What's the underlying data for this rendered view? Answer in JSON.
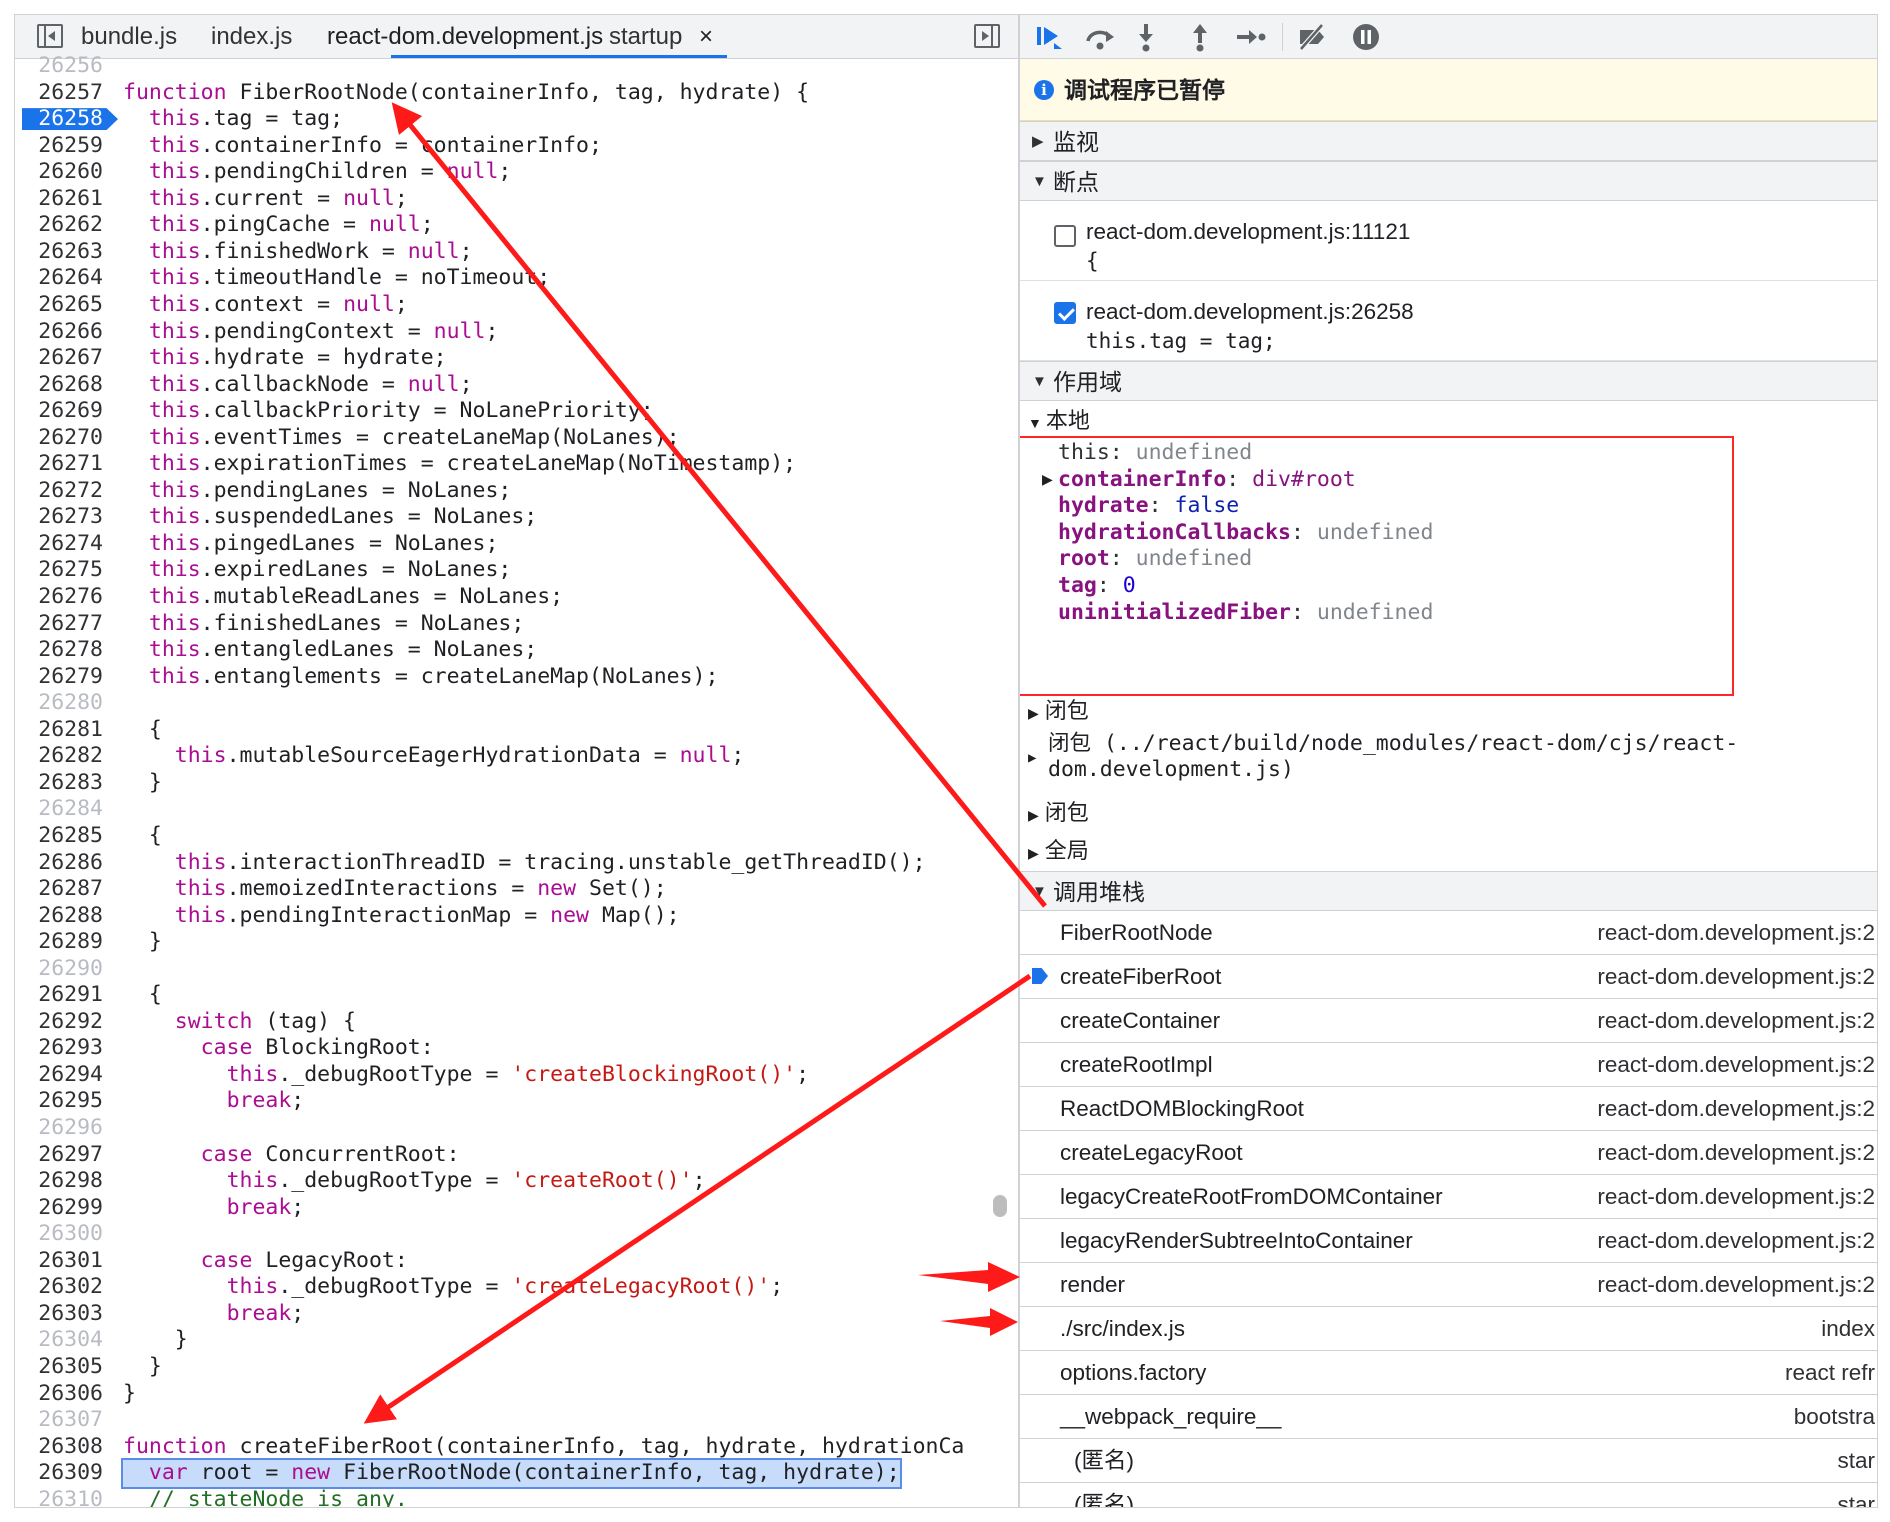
{
  "editor": {
    "tabs": [
      "bundle.js",
      "index.js",
      "react-dom.development.js",
      "startup"
    ],
    "close_glyph": "×",
    "lines": [
      {
        "num": "26256",
        "dim": true,
        "html": ""
      },
      {
        "num": "26257",
        "html": "<span class=\"kw\">function</span> FiberRootNode(containerInfo, tag, hydrate) {"
      },
      {
        "num": "26258",
        "breakpoint": true,
        "html": "  <span class=\"k\">this</span>.tag = tag;"
      },
      {
        "num": "26259",
        "html": "  <span class=\"k\">this</span>.containerInfo = containerInfo;"
      },
      {
        "num": "26260",
        "html": "  <span class=\"k\">this</span>.pendingChildren = <span class=\"k\">null</span>;"
      },
      {
        "num": "26261",
        "html": "  <span class=\"k\">this</span>.current = <span class=\"k\">null</span>;"
      },
      {
        "num": "26262",
        "html": "  <span class=\"k\">this</span>.pingCache = <span class=\"k\">null</span>;"
      },
      {
        "num": "26263",
        "html": "  <span class=\"k\">this</span>.finishedWork = <span class=\"k\">null</span>;"
      },
      {
        "num": "26264",
        "html": "  <span class=\"k\">this</span>.timeoutHandle = noTimeout;"
      },
      {
        "num": "26265",
        "html": "  <span class=\"k\">this</span>.context = <span class=\"k\">null</span>;"
      },
      {
        "num": "26266",
        "html": "  <span class=\"k\">this</span>.pendingContext = <span class=\"k\">null</span>;"
      },
      {
        "num": "26267",
        "html": "  <span class=\"k\">this</span>.hydrate = hydrate;"
      },
      {
        "num": "26268",
        "html": "  <span class=\"k\">this</span>.callbackNode = <span class=\"k\">null</span>;"
      },
      {
        "num": "26269",
        "html": "  <span class=\"k\">this</span>.callbackPriority = NoLanePriority;"
      },
      {
        "num": "26270",
        "html": "  <span class=\"k\">this</span>.eventTimes = createLaneMap(NoLanes);"
      },
      {
        "num": "26271",
        "html": "  <span class=\"k\">this</span>.expirationTimes = createLaneMap(NoTimestamp);"
      },
      {
        "num": "26272",
        "html": "  <span class=\"k\">this</span>.pendingLanes = NoLanes;"
      },
      {
        "num": "26273",
        "html": "  <span class=\"k\">this</span>.suspendedLanes = NoLanes;"
      },
      {
        "num": "26274",
        "html": "  <span class=\"k\">this</span>.pingedLanes = NoLanes;"
      },
      {
        "num": "26275",
        "html": "  <span class=\"k\">this</span>.expiredLanes = NoLanes;"
      },
      {
        "num": "26276",
        "html": "  <span class=\"k\">this</span>.mutableReadLanes = NoLanes;"
      },
      {
        "num": "26277",
        "html": "  <span class=\"k\">this</span>.finishedLanes = NoLanes;"
      },
      {
        "num": "26278",
        "html": "  <span class=\"k\">this</span>.entangledLanes = NoLanes;"
      },
      {
        "num": "26279",
        "html": "  <span class=\"k\">this</span>.entanglements = createLaneMap(NoLanes);"
      },
      {
        "num": "26280",
        "dim": true,
        "html": ""
      },
      {
        "num": "26281",
        "html": "  {"
      },
      {
        "num": "26282",
        "html": "    <span class=\"k\">this</span>.mutableSourceEagerHydrationData = <span class=\"k\">null</span>;"
      },
      {
        "num": "26283",
        "html": "  }"
      },
      {
        "num": "26284",
        "dim": true,
        "html": ""
      },
      {
        "num": "26285",
        "html": "  {"
      },
      {
        "num": "26286",
        "html": "    <span class=\"k\">this</span>.interactionThreadID = tracing.unstable_getThreadID();"
      },
      {
        "num": "26287",
        "html": "    <span class=\"k\">this</span>.memoizedInteractions = <span class=\"k\">new</span> Set();"
      },
      {
        "num": "26288",
        "html": "    <span class=\"k\">this</span>.pendingInteractionMap = <span class=\"k\">new</span> Map();"
      },
      {
        "num": "26289",
        "html": "  }"
      },
      {
        "num": "26290",
        "dim": true,
        "html": ""
      },
      {
        "num": "26291",
        "html": "  {"
      },
      {
        "num": "26292",
        "html": "    <span class=\"k\">switch</span> (tag) {"
      },
      {
        "num": "26293",
        "html": "      <span class=\"k\">case</span> BlockingRoot:"
      },
      {
        "num": "26294",
        "html": "        <span class=\"k\">this</span>._debugRootType = <span class=\"s\">'createBlockingRoot()'</span>;"
      },
      {
        "num": "26295",
        "html": "        <span class=\"k\">break</span>;"
      },
      {
        "num": "26296",
        "dim": true,
        "html": ""
      },
      {
        "num": "26297",
        "html": "      <span class=\"k\">case</span> ConcurrentRoot:"
      },
      {
        "num": "26298",
        "html": "        <span class=\"k\">this</span>._debugRootType = <span class=\"s\">'createRoot()'</span>;"
      },
      {
        "num": "26299",
        "html": "        <span class=\"k\">break</span>;"
      },
      {
        "num": "26300",
        "dim": true,
        "html": ""
      },
      {
        "num": "26301",
        "html": "      <span class=\"k\">case</span> LegacyRoot:"
      },
      {
        "num": "26302",
        "html": "        <span class=\"k\">this</span>._debugRootType = <span class=\"s\">'createLegacyRoot()'</span>;"
      },
      {
        "num": "26303",
        "html": "        <span class=\"k\">break</span>;"
      },
      {
        "num": "26304",
        "dim": true,
        "html": "    }"
      },
      {
        "num": "26305",
        "html": "  }"
      },
      {
        "num": "26306",
        "html": "}"
      },
      {
        "num": "26307",
        "dim": true,
        "html": ""
      },
      {
        "num": "26308",
        "html": "<span class=\"kw\">function</span> createFiberRoot(containerInfo, tag, hydrate, hydrationCa"
      },
      {
        "num": "26309",
        "exec": true,
        "html": "  <span class=\"k\">var</span> root = <span class=\"k\">new</span> FiberRootNode(containerInfo, tag, hydrate);"
      },
      {
        "num": "26310",
        "dim": true,
        "html": "  <span class=\"c\">// stateNode is any.</span>"
      }
    ]
  },
  "debugger": {
    "toolbar_icons": [
      "resume-icon",
      "step-over-icon",
      "step-into-icon",
      "step-out-icon",
      "step-icon",
      "deactivate-breakpoints-icon",
      "pause-on-exceptions-icon"
    ],
    "paused_message": "调试程序已暂停",
    "sections": {
      "watch": "监视",
      "breakpoints": "断点",
      "scope": "作用域",
      "call_stack": "调用堆栈"
    },
    "breakpoints": [
      {
        "file": "react-dom.development.js:11121",
        "code": "{",
        "checked": false
      },
      {
        "file": "react-dom.development.js:26258",
        "code": "this.tag = tag;",
        "checked": true
      }
    ],
    "scope": {
      "local_label": "本地",
      "local": [
        {
          "name": "this",
          "value": "undefined",
          "type": "undef",
          "plain": true
        },
        {
          "name": "containerInfo",
          "value": "div#root",
          "type": "node",
          "expandable": true
        },
        {
          "name": "hydrate",
          "value": "false",
          "type": "kw"
        },
        {
          "name": "hydrationCallbacks",
          "value": "undefined",
          "type": "undef"
        },
        {
          "name": "root",
          "value": "undefined",
          "type": "undef"
        },
        {
          "name": "tag",
          "value": "0",
          "type": "num"
        },
        {
          "name": "uninitializedFiber",
          "value": "undefined",
          "type": "undef"
        }
      ],
      "closure1": "闭包",
      "closure2_line1": "闭包 (../react/build/node_modules/react-dom/cjs/react-",
      "closure2_line2": "dom.development.js)",
      "closure3": "闭包",
      "global": "全局"
    },
    "call_stack": [
      {
        "fn": "FiberRootNode",
        "loc": "react-dom.development.js:2"
      },
      {
        "fn": "createFiberRoot",
        "loc": "react-dom.development.js:2",
        "current": true
      },
      {
        "fn": "createContainer",
        "loc": "react-dom.development.js:2"
      },
      {
        "fn": "createRootImpl",
        "loc": "react-dom.development.js:2"
      },
      {
        "fn": "ReactDOMBlockingRoot",
        "loc": "react-dom.development.js:2"
      },
      {
        "fn": "createLegacyRoot",
        "loc": "react-dom.development.js:2"
      },
      {
        "fn": "legacyCreateRootFromDOMContainer",
        "loc": "react-dom.development.js:2"
      },
      {
        "fn": "legacyRenderSubtreeIntoContainer",
        "loc": "react-dom.development.js:2"
      },
      {
        "fn": "render",
        "loc": "react-dom.development.js:2"
      },
      {
        "fn": "./src/index.js",
        "loc": "index"
      },
      {
        "fn": "options.factory",
        "loc": "react refr"
      },
      {
        "fn": "__webpack_require__",
        "loc": "bootstra"
      },
      {
        "fn": "(匿名)",
        "loc": "star"
      },
      {
        "fn": "(匿名)",
        "loc": "star"
      }
    ]
  },
  "colors": {
    "annotation": "#ff1a1a",
    "accent": "#1a73e8"
  }
}
